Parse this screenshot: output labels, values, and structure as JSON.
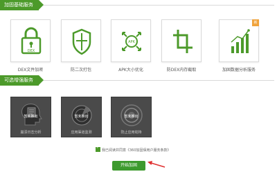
{
  "sections": {
    "basic_title": "加固基础服务",
    "optional_title": "可选增强服务"
  },
  "basic_services": [
    {
      "label": "DEX文件加密",
      "icon_text": "DEX"
    },
    {
      "label": "防二次打包"
    },
    {
      "label": "APK大小优化",
      "icon_text": "APK"
    },
    {
      "label": "防DEX内存截取"
    },
    {
      "label": "加固数据分析服务",
      "badge": "新"
    }
  ],
  "optional_services": [
    {
      "label": "崩溃日志分析",
      "overlay": "暂未推出"
    },
    {
      "label": "应用渠道监测",
      "overlay": "暂未推出"
    },
    {
      "label": "防止应用劫持",
      "overlay": "暂未推出"
    }
  ],
  "agreement": {
    "checked": true,
    "text": "我已阅读并同意《360加固保用户服务条款》"
  },
  "start_button": {
    "label": "开始加固"
  },
  "colors": {
    "brand_green": "#4c9a2a",
    "badge_orange": "#f0a33c",
    "arrow_red": "#e03030"
  }
}
